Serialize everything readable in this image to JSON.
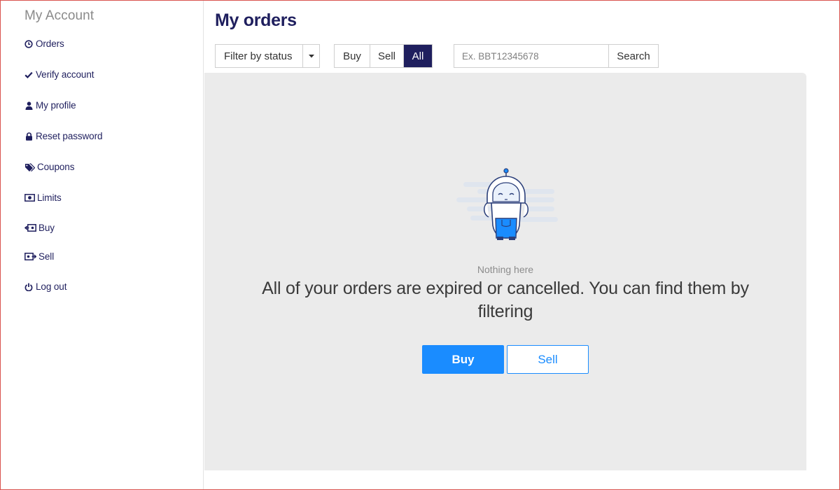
{
  "sidebar": {
    "title": "My Account",
    "items": [
      {
        "label": "Orders",
        "icon": "clock-icon"
      },
      {
        "label": "Verify account",
        "icon": "check-icon"
      },
      {
        "label": "My profile",
        "icon": "user-icon"
      },
      {
        "label": "Reset password",
        "icon": "lock-icon"
      },
      {
        "label": "Coupons",
        "icon": "tags-icon"
      },
      {
        "label": "Limits",
        "icon": "money-icon"
      },
      {
        "label": "Buy",
        "icon": "buy-icon"
      },
      {
        "label": "Sell",
        "icon": "sell-icon"
      },
      {
        "label": "Log out",
        "icon": "power-icon"
      }
    ]
  },
  "main": {
    "title": "My orders",
    "filter": {
      "label": "Filter by status"
    },
    "type_toggle": {
      "buy": "Buy",
      "sell": "Sell",
      "all": "All",
      "active": "All"
    },
    "search": {
      "placeholder": "Ex. BBT12345678",
      "button": "Search"
    },
    "empty": {
      "subtitle": "Nothing here",
      "message": "All of your orders are expired or cancelled. You can find them by filtering",
      "buy_button": "Buy",
      "sell_button": "Sell"
    }
  },
  "colors": {
    "navy": "#1f1f5e",
    "accent": "#1a8cff",
    "panel_bg": "#ebebeb",
    "frame": "#d9534f"
  }
}
